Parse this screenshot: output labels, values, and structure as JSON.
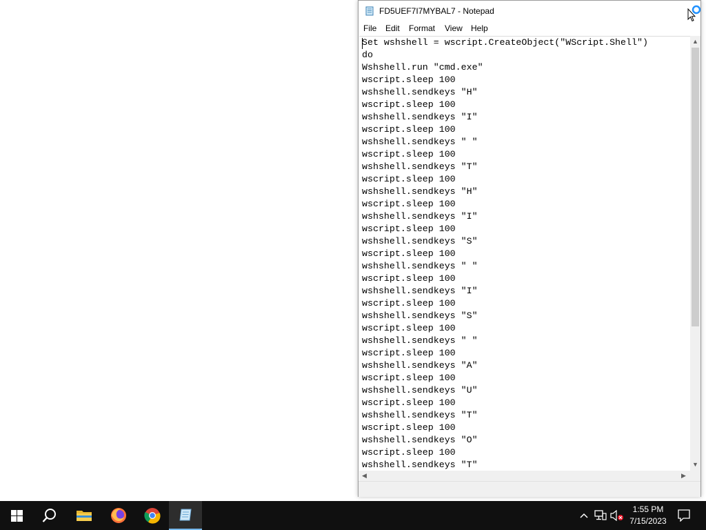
{
  "window": {
    "title": "FD5UEF7I7MYBAL7 - Notepad",
    "menu": [
      "File",
      "Edit",
      "Format",
      "View",
      "Help"
    ]
  },
  "editor": {
    "lines": [
      "Set wshshell = wscript.CreateObject(\"WScript.Shell\")",
      "do",
      "Wshshell.run \"cmd.exe\"",
      "wscript.sleep 100",
      "wshshell.sendkeys \"H\"",
      "wscript.sleep 100",
      "wshshell.sendkeys \"I\"",
      "wscript.sleep 100",
      "wshshell.sendkeys \" \"",
      "wscript.sleep 100",
      "wshshell.sendkeys \"T\"",
      "wscript.sleep 100",
      "wshshell.sendkeys \"H\"",
      "wscript.sleep 100",
      "wshshell.sendkeys \"I\"",
      "wscript.sleep 100",
      "wshshell.sendkeys \"S\"",
      "wscript.sleep 100",
      "wshshell.sendkeys \" \"",
      "wscript.sleep 100",
      "wshshell.sendkeys \"I\"",
      "wscript.sleep 100",
      "wshshell.sendkeys \"S\"",
      "wscript.sleep 100",
      "wshshell.sendkeys \" \"",
      "wscript.sleep 100",
      "wshshell.sendkeys \"A\"",
      "wscript.sleep 100",
      "wshshell.sendkeys \"U\"",
      "wscript.sleep 100",
      "wshshell.sendkeys \"T\"",
      "wscript.sleep 100",
      "wshshell.sendkeys \"O\"",
      "wscript.sleep 100",
      "wshshell.sendkeys \"T\""
    ]
  },
  "taskbar": {
    "apps": [
      {
        "name": "start-button",
        "icon": "windows-logo-icon"
      },
      {
        "name": "search-button",
        "icon": "search-icon"
      },
      {
        "name": "file-explorer-button",
        "icon": "folder-icon"
      },
      {
        "name": "firefox-button",
        "icon": "firefox-icon"
      },
      {
        "name": "chrome-button",
        "icon": "chrome-icon"
      },
      {
        "name": "notepad-taskbar-button",
        "icon": "notepad-icon",
        "active": true
      }
    ],
    "clock": {
      "time": "1:55 PM",
      "date": "7/15/2023"
    }
  },
  "colors": {
    "taskbar_bg": "#101010",
    "active_app_accent": "#76b9ed",
    "busy_indicator": "#1e90ff"
  }
}
